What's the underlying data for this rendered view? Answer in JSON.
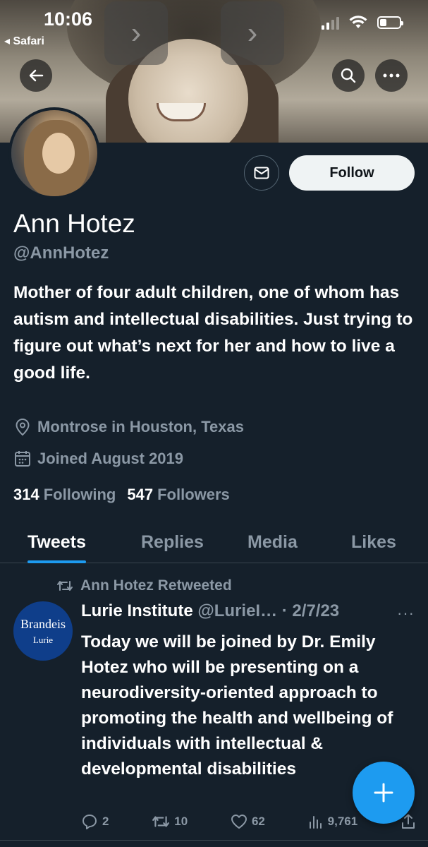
{
  "status_bar": {
    "time": "10:06",
    "back_app": "◂ Safari"
  },
  "profile": {
    "name": "Ann Hotez",
    "handle": "@AnnHotez",
    "bio": "Mother of four adult children, one of whom has autism and intellectual disabilities. Just trying to figure out what’s next for her and how to live a good life.",
    "location": "Montrose in Houston, Texas",
    "joined": "Joined August 2019",
    "following_count": "314",
    "following_label": "Following",
    "followers_count": "547",
    "followers_label": "Followers",
    "follow_button": "Follow"
  },
  "tabs": [
    {
      "label": "Tweets",
      "active": true
    },
    {
      "label": "Replies",
      "active": false
    },
    {
      "label": "Media",
      "active": false
    },
    {
      "label": "Likes",
      "active": false
    }
  ],
  "tweet": {
    "retweet_label": "Ann Hotez Retweeted",
    "avatar_text_1": "Brandeis",
    "avatar_text_2": "Lurie",
    "author": "Lurie Institute",
    "author_handle": "@LurieI…",
    "date": "· 2/7/23",
    "more": "···",
    "text": "Today we will be joined by Dr. Emily Hotez who will be presenting on a neurodiversity-oriented approach to promoting the health and wellbeing of individuals with intellectual & developmental disabilities",
    "replies": "2",
    "retweets": "10",
    "likes": "62",
    "views": "9,761"
  },
  "fab": {
    "label": "+"
  },
  "icons": {
    "back": "back-arrow-icon",
    "search": "search-icon",
    "more": "more-icon",
    "message": "envelope-icon",
    "location": "location-pin-icon",
    "calendar": "calendar-icon",
    "retweet": "retweet-icon",
    "reply": "reply-icon",
    "like": "heart-icon",
    "views": "views-icon",
    "share": "share-icon"
  },
  "colors": {
    "background": "#15202b",
    "accent": "#1d9bf0",
    "muted_text": "#8b98a5",
    "follow_button_bg": "#eff3f4"
  }
}
